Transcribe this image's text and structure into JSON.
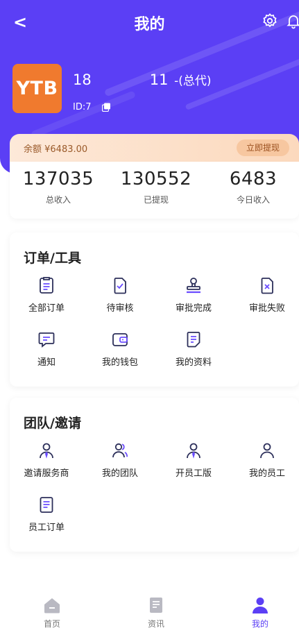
{
  "header": {
    "back_label": "<",
    "title": "我的",
    "phone": "18        11",
    "role": "-(总代)",
    "id_label": "ID:7  "
  },
  "avatar": {
    "text": "YTB",
    "color": "#f07a2e"
  },
  "balance": {
    "label": "余额 ¥6483.00",
    "withdraw_label": "立即提现"
  },
  "stats": [
    {
      "value": "137035",
      "label": "总收入"
    },
    {
      "value": "130552",
      "label": "已提现"
    },
    {
      "value": "6483",
      "label": "今日收入"
    }
  ],
  "orders": {
    "title": "订单/工具",
    "items": [
      {
        "label": "全部订单",
        "icon": "clipboard-list-icon"
      },
      {
        "label": "待审核",
        "icon": "doc-check-icon"
      },
      {
        "label": "审批完成",
        "icon": "stamp-icon"
      },
      {
        "label": "审批失败",
        "icon": "doc-x-icon"
      },
      {
        "label": "通知",
        "icon": "message-icon"
      },
      {
        "label": "我的钱包",
        "icon": "wallet-icon"
      },
      {
        "label": "我的资料",
        "icon": "profile-doc-icon"
      }
    ]
  },
  "team": {
    "title": "团队/邀请",
    "items": [
      {
        "label": "邀请服务商",
        "icon": "person-tie-icon"
      },
      {
        "label": "我的团队",
        "icon": "team-icon"
      },
      {
        "label": "开员工版",
        "icon": "person-tie-icon"
      },
      {
        "label": "我的员工",
        "icon": "person-icon"
      },
      {
        "label": "员工订单",
        "icon": "doc-icon"
      }
    ]
  },
  "tabbar": {
    "items": [
      {
        "label": "首页",
        "icon": "home-icon"
      },
      {
        "label": "资讯",
        "icon": "news-icon"
      },
      {
        "label": "我的",
        "icon": "user-icon"
      }
    ],
    "active_index": 2
  },
  "colors": {
    "primary": "#5b3ff5",
    "icon_stroke": "#2c2f5a",
    "icon_accent": "#6a4cff",
    "balance_text": "#9a5a2a"
  }
}
